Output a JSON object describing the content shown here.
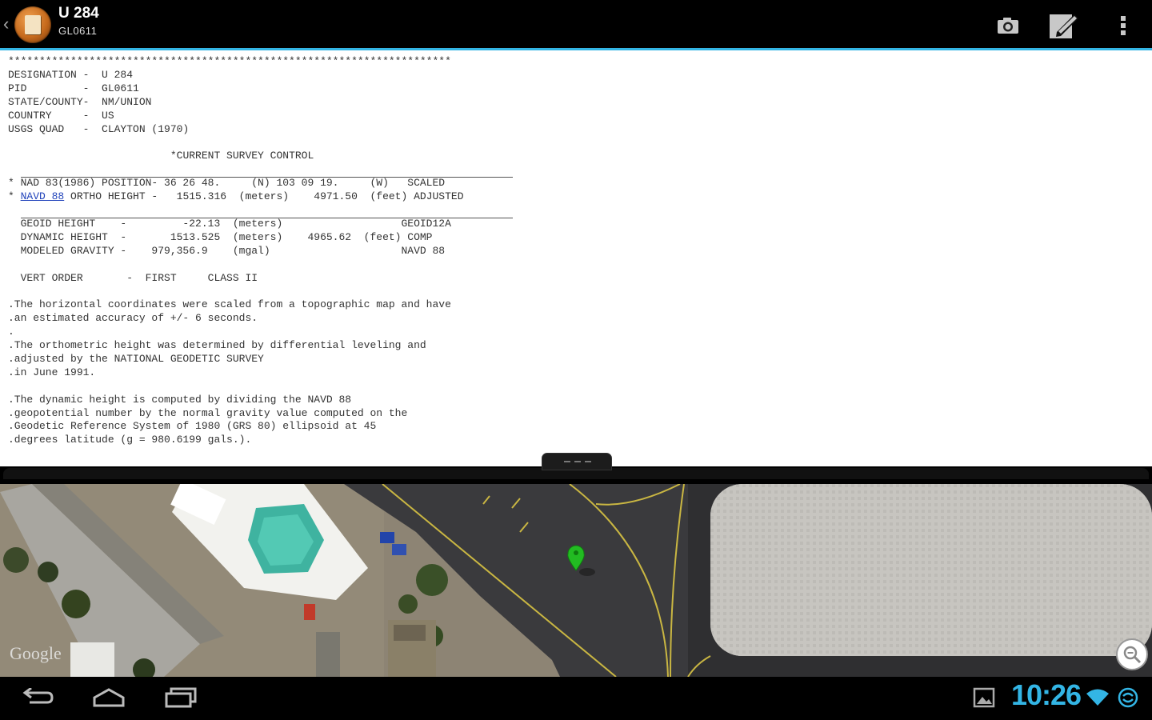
{
  "action_bar": {
    "title": "U 284",
    "subtitle": "GL0611",
    "icons": [
      "app-icon",
      "camera-icon",
      "edit-icon",
      "overflow-menu-icon"
    ]
  },
  "datasheet": {
    "stars": "***********************************************************************",
    "header": [
      "DESIGNATION -  U 284",
      "PID         -  GL0611",
      "STATE/COUNTY-  NM/UNION",
      "COUNTRY     -  US",
      "USGS QUAD   -  CLAYTON (1970)"
    ],
    "section_title": "*CURRENT SURVEY CONTROL",
    "position_line": "* NAD 83(1986) POSITION- 36 26 48.     (N) 103 09 19.     (W)   SCALED",
    "height_marker": "* ",
    "height_link": "NAVD 88",
    "height_line_rest": " ORTHO HEIGHT -   1515.316  (meters)    4971.50  (feet) ADJUSTED",
    "height_rows": [
      "  GEOID HEIGHT    -         -22.13  (meters)                   GEOID12A",
      "  DYNAMIC HEIGHT  -       1513.525  (meters)    4965.62  (feet) COMP",
      "  MODELED GRAVITY -    979,356.9    (mgal)                     NAVD 88"
    ],
    "vert_order": "  VERT ORDER       -  FIRST     CLASS II",
    "notes": [
      ".The horizontal coordinates were scaled from a topographic map and have",
      ".an estimated accuracy of +/- 6 seconds.",
      ".",
      ".The orthometric height was determined by differential leveling and",
      ".adjusted by the NATIONAL GEODETIC SURVEY",
      ".in June 1991.",
      "",
      ".The dynamic height is computed by dividing the NAVD 88",
      ".geopotential number by the normal gravity value computed on the",
      ".Geodetic Reference System of 1980 (GRS 80) ellipsoid at 45",
      ".degrees latitude (g = 980.6199 gals.)."
    ]
  },
  "map": {
    "attribution": "Google",
    "marker_color": "#22bb22"
  },
  "status_bar": {
    "time": "10:26",
    "accent": "#33b5e5"
  }
}
